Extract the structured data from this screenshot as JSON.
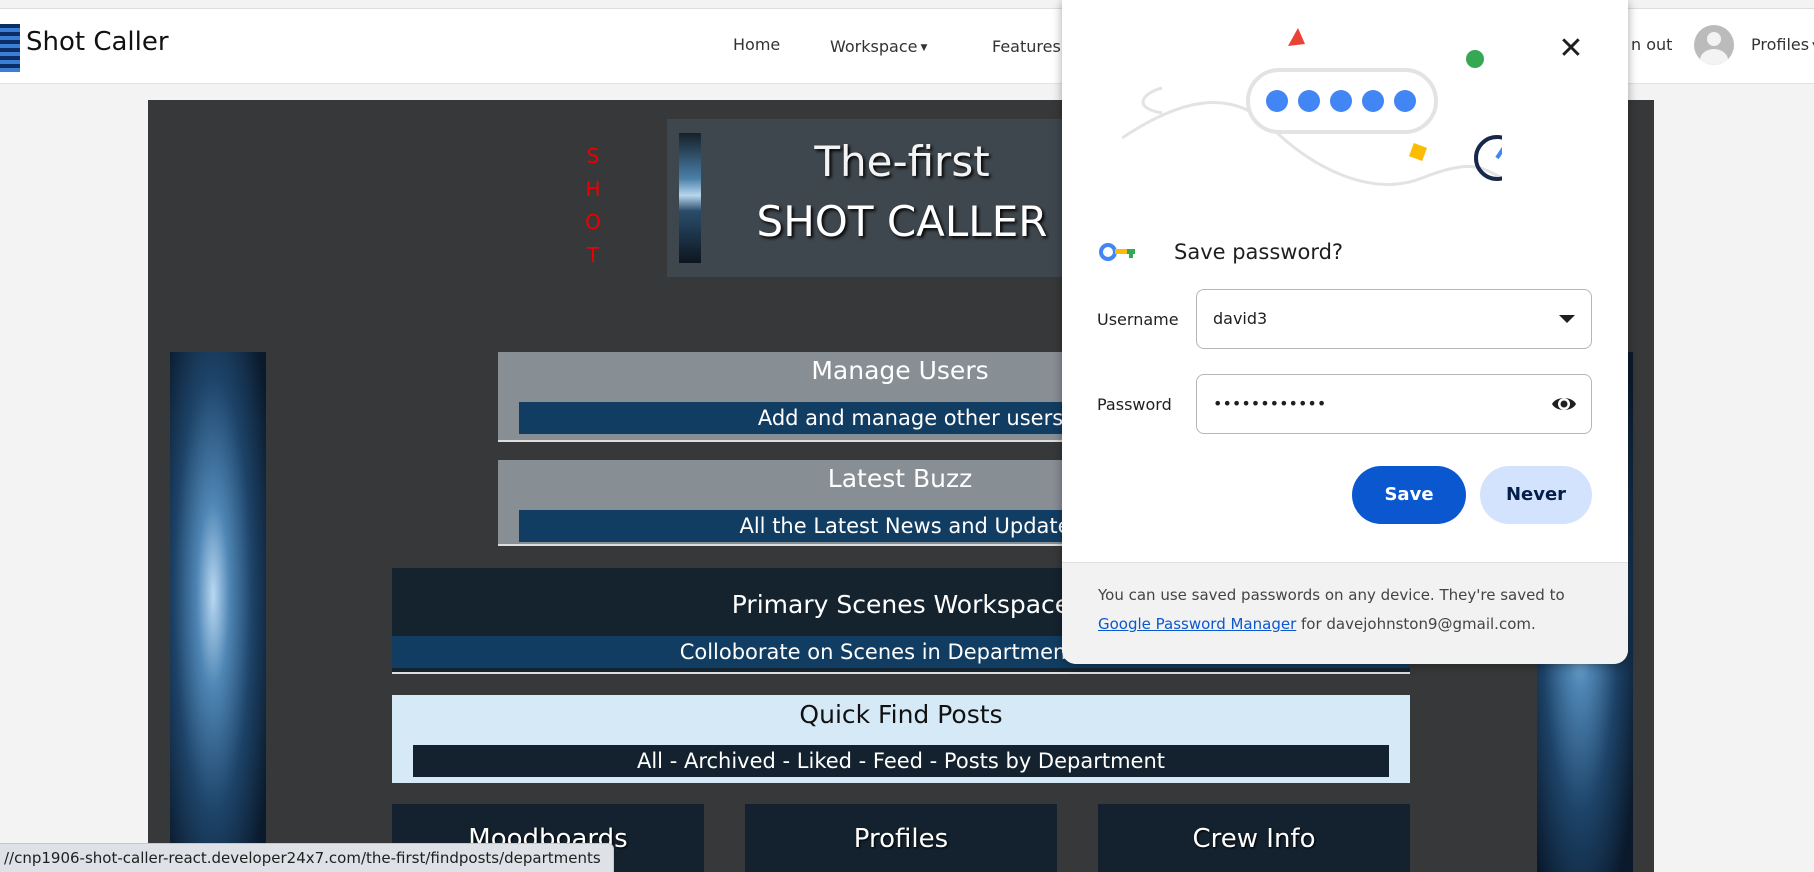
{
  "navbar": {
    "brand": "Shot Caller",
    "links": {
      "home": "Home",
      "workspace": "Workspace",
      "features": "Features",
      "signout": "n out",
      "profiles": "Profiles"
    }
  },
  "hero": {
    "vertical_letters": [
      "S",
      "H",
      "O",
      "T"
    ],
    "line1": "The-first",
    "line2": "SHOT CALLER"
  },
  "cards": {
    "manage_users": {
      "title": "Manage Users",
      "subtitle": "Add and manage other users"
    },
    "latest_buzz": {
      "title": "Latest Buzz",
      "subtitle": "All the Latest News and Updates"
    },
    "primary_scenes": {
      "title": "Primary Scenes Workspace",
      "subtitle": "Colloborate on Scenes in Department Wor"
    },
    "quick_find": {
      "title": "Quick Find Posts",
      "subtitle": "All - Archived - Liked - Feed - Posts by Department"
    }
  },
  "tiles": [
    "Moodboards",
    "Profiles",
    "Crew Info"
  ],
  "status_bar": {
    "url": "//cnp1906-shot-caller-react.developer24x7.com/the-first/findposts/departments"
  },
  "password_dialog": {
    "title": "Save password?",
    "username_label": "Username",
    "username_value": "david3",
    "password_label": "Password",
    "password_masked": "••••••••••••",
    "save_label": "Save",
    "never_label": "Never",
    "footer_pre": "You can use saved passwords on any device. They're saved to ",
    "footer_link": "Google Password Manager",
    "footer_post": " for davejohnston9@gmail.com.",
    "icons": [
      "close-icon",
      "key-icon",
      "dropdown-arrow-icon",
      "eye-icon"
    ]
  },
  "colors": {
    "primary_button": "#0b57d0",
    "secondary_button": "#d3e3fd",
    "page_panel": "#363839",
    "subtitle_bar": "#113d63",
    "vertical_text": "#e00000"
  }
}
